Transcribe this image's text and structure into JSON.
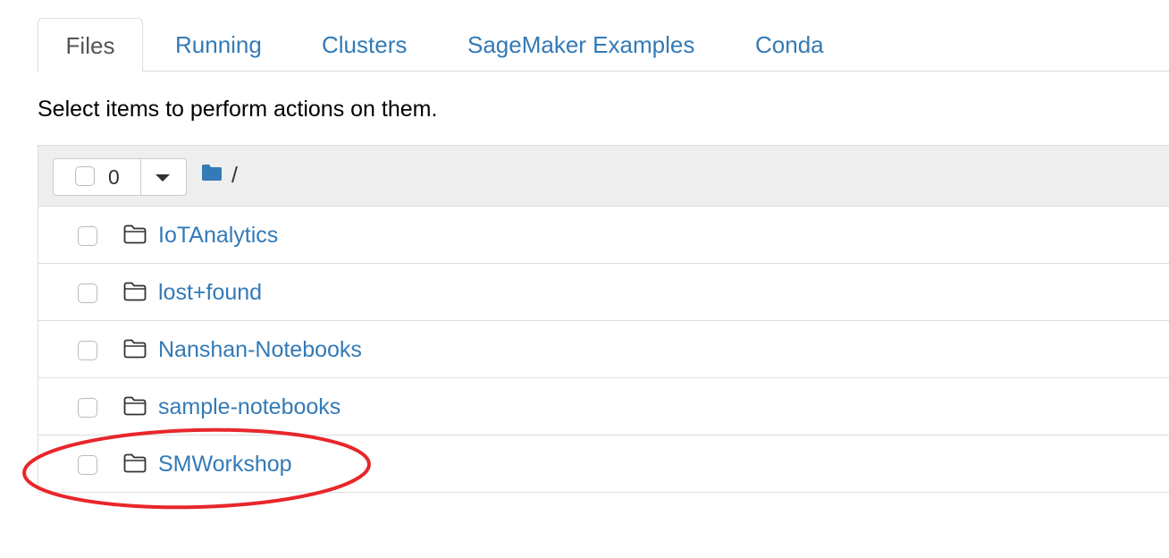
{
  "tabs": [
    {
      "label": "Files",
      "active": true
    },
    {
      "label": "Running",
      "active": false
    },
    {
      "label": "Clusters",
      "active": false
    },
    {
      "label": "SageMaker Examples",
      "active": false
    },
    {
      "label": "Conda",
      "active": false
    }
  ],
  "instructions": "Select items to perform actions on them.",
  "toolbar": {
    "selected_count": "0",
    "breadcrumb": "/"
  },
  "items": [
    {
      "name": "IoTAnalytics",
      "type": "folder"
    },
    {
      "name": "lost+found",
      "type": "folder"
    },
    {
      "name": "Nanshan-Notebooks",
      "type": "folder"
    },
    {
      "name": "sample-notebooks",
      "type": "folder"
    },
    {
      "name": "SMWorkshop",
      "type": "folder"
    }
  ],
  "colors": {
    "link": "#337ab7",
    "annotation": "#e8262a",
    "header_bg": "#eeeeee"
  }
}
